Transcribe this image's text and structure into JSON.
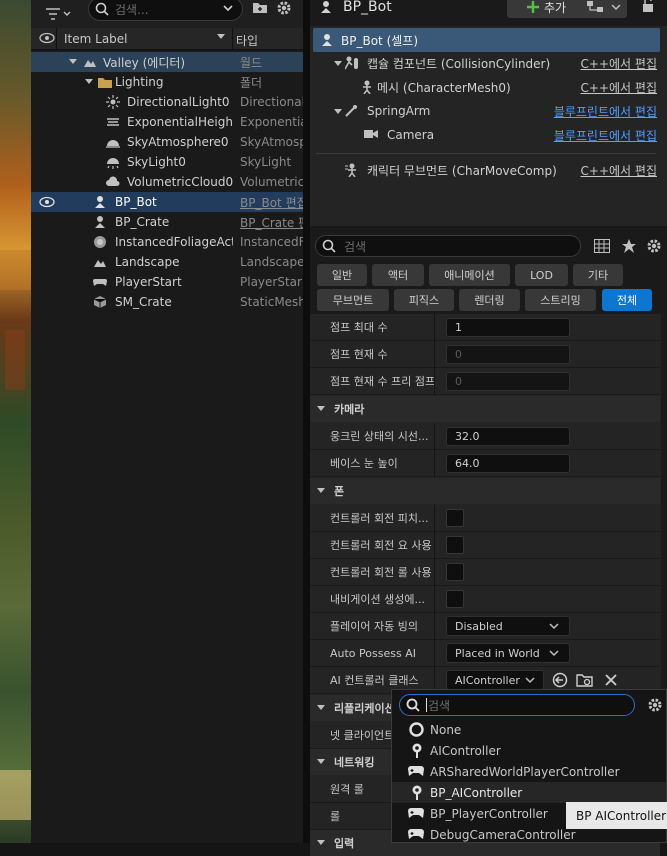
{
  "outliner": {
    "search_placeholder": "검색...",
    "col_label": "Item Label",
    "col_type": "타입",
    "rows": [
      {
        "label": "Valley (에디터)",
        "type": "월드"
      },
      {
        "label": "Lighting",
        "type": "폴더"
      },
      {
        "label": "DirectionalLight0",
        "type": "Directional"
      },
      {
        "label": "ExponentialHeightF",
        "type": "Exponentia"
      },
      {
        "label": "SkyAtmosphere0",
        "type": "SkyAtmosp"
      },
      {
        "label": "SkyLight0",
        "type": "SkyLight"
      },
      {
        "label": "VolumetricCloud0",
        "type": "Volumetric"
      },
      {
        "label": "BP_Bot",
        "type": "BP_Bot 편집"
      },
      {
        "label": "BP_Crate",
        "type": "BP_Crate 편"
      },
      {
        "label": "InstancedFoliageAct",
        "type": "InstancedF"
      },
      {
        "label": "Landscape",
        "type": "Landscape"
      },
      {
        "label": "PlayerStart",
        "type": "PlayerStar"
      },
      {
        "label": "SM_Crate",
        "type": "StaticMesh"
      }
    ]
  },
  "details": {
    "title": "BP_Bot",
    "add_label": "추가",
    "components": [
      {
        "label": "BP_Bot (셀프)",
        "edit": ""
      },
      {
        "label": "캡슐 컴포넌트 (CollisionCylinder)",
        "edit": "C++에서 편집"
      },
      {
        "label": "메시 (CharacterMesh0)",
        "edit": "C++에서 편집"
      },
      {
        "label": "SpringArm",
        "edit": "블루프린트에서 편집"
      },
      {
        "label": "Camera",
        "edit": "블루프린트에서 편집"
      },
      {
        "label": "캐릭터 무브먼트 (CharMoveComp)",
        "edit": "C++에서 편집"
      }
    ],
    "search_placeholder": "검색",
    "categories_row1": [
      "일반",
      "액터",
      "애니메이션",
      "LOD",
      "기타"
    ],
    "categories_row2": [
      "무브먼트",
      "피직스",
      "렌더링",
      "스트리밍",
      "전체"
    ],
    "props": {
      "jump_max_label": "점프 최대 수",
      "jump_max_value": "1",
      "jump_cur_label": "점프 현재 수",
      "jump_cur_value": "0",
      "jump_free_label": "점프 현재 수 프리 점프",
      "jump_free_value": "0",
      "camera_section": "카메라",
      "crouched_label": "웅크린 상태의 시선...",
      "crouched_value": "32.0",
      "base_eye_label": "베이스 눈 높이",
      "base_eye_value": "64.0",
      "pawn_section": "폰",
      "ctrl_pitch_label": "컨트롤러 회전 피치...",
      "ctrl_yaw_label": "컨트롤러 회전 요 사용",
      "ctrl_roll_label": "컨트롤러 회전 롤 사용",
      "nav_label": "내비게이션 생성에...",
      "auto_possess_player_label": "플레이어 자동 빙의",
      "auto_possess_player_value": "Disabled",
      "auto_possess_ai_label": "Auto Possess AI",
      "auto_possess_ai_value": "Placed in World",
      "ai_ctrl_label": "AI 컨트롤러 클래스",
      "ai_ctrl_value": "AIController",
      "replication_section": "리플리케이션",
      "net_client_label": "넷 클라이언트",
      "networking_section": "네트워킹",
      "remote_role_label": "원격 롤",
      "role_label": "롤",
      "input_section": "입력"
    }
  },
  "popup": {
    "search_value": "검색",
    "items": [
      "None",
      "AIController",
      "ARSharedWorldPlayerController",
      "BP_AIController",
      "BP_PlayerController",
      "DebugCameraController"
    ]
  },
  "tooltip": "BP AIController"
}
